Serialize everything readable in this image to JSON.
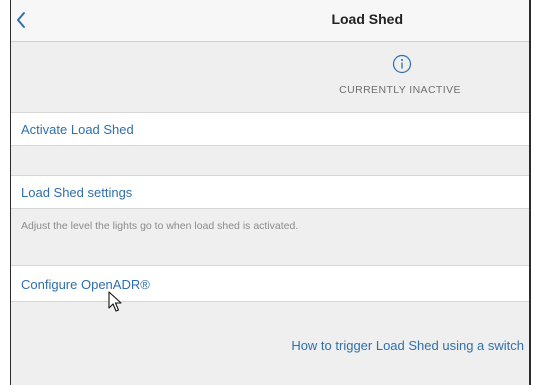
{
  "header": {
    "title": "Load Shed",
    "back_icon": "chevron-left-icon"
  },
  "status": {
    "icon": "info-icon",
    "text": "CURRENTLY INACTIVE"
  },
  "rows": {
    "activate": "Activate Load Shed",
    "settings": "Load Shed settings",
    "configure": "Configure OpenADR®"
  },
  "settings_description": "Adjust the level the lights go to when load shed is activated.",
  "links": {
    "how_to_trigger": "How to trigger Load Shed using a switch"
  },
  "colors": {
    "accent": "#2f6fad",
    "background": "#efefef",
    "row": "#ffffff"
  }
}
